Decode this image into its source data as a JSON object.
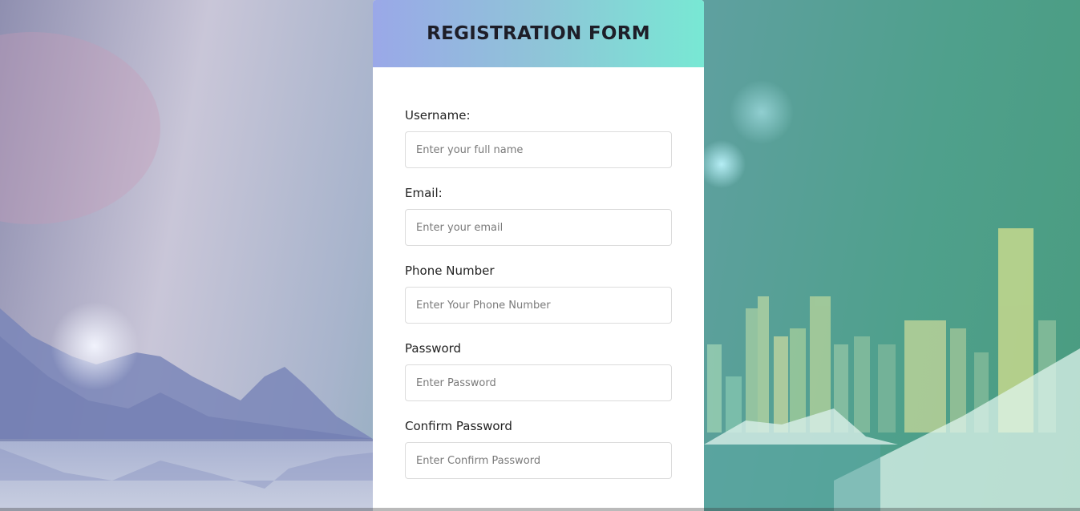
{
  "form": {
    "title": "REGISTRATION FORM",
    "fields": [
      {
        "label": "Username:",
        "placeholder": "Enter your full name",
        "type": "text"
      },
      {
        "label": "Email:",
        "placeholder": "Enter your email",
        "type": "email"
      },
      {
        "label": "Phone Number",
        "placeholder": "Enter Your Phone Number",
        "type": "tel"
      },
      {
        "label": "Password",
        "placeholder": "Enter Password",
        "type": "password"
      },
      {
        "label": "Confirm Password",
        "placeholder": "Enter Confirm Password",
        "type": "password"
      }
    ]
  },
  "colors": {
    "header_gradient_start": "#9aa8e8",
    "header_gradient_end": "#78e8d4",
    "card_background": "#ffffff"
  }
}
